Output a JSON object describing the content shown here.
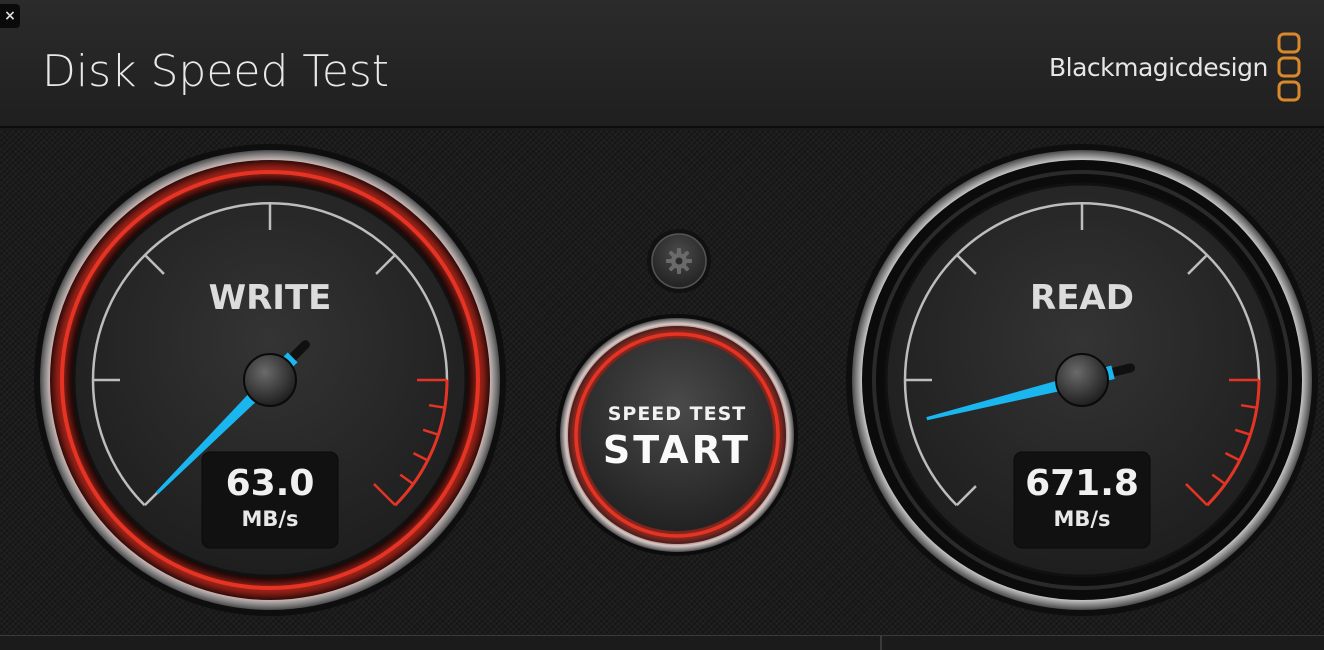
{
  "window": {
    "title": "Disk Speed Test",
    "close_label": "×"
  },
  "brand": {
    "name": "Blackmagicdesign",
    "logo_color": "#d9892b"
  },
  "write_gauge": {
    "label": "WRITE",
    "value": "63.0",
    "unit": "MB/s",
    "needle_color": "#19b6f0",
    "ring_color": "#e53324",
    "active": true
  },
  "read_gauge": {
    "label": "READ",
    "value": "671.8",
    "unit": "MB/s",
    "needle_color": "#19b6f0",
    "active": false
  },
  "start_button": {
    "line1": "SPEED TEST",
    "line2": "START",
    "ring_color": "#e53324"
  },
  "settings_button": {
    "icon": "gear-icon"
  }
}
